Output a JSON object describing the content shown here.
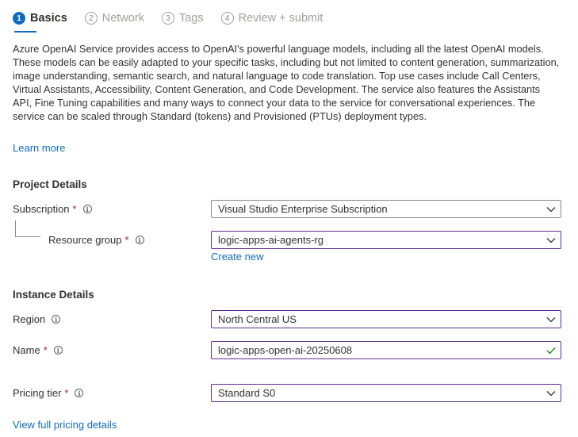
{
  "steps": [
    {
      "number": "1",
      "label": "Basics"
    },
    {
      "number": "2",
      "label": "Network"
    },
    {
      "number": "3",
      "label": "Tags"
    },
    {
      "number": "4",
      "label": "Review + submit"
    }
  ],
  "description": "Azure OpenAI Service provides access to OpenAI's powerful language models, including all the latest OpenAI models. These models can be easily adapted to your specific tasks, including but not limited to content generation, summarization, image understanding, semantic search, and natural language to code translation. Top use cases include Call Centers, Virtual Assistants, Accessibility, Content Generation, and Code Development. The service also features the Assistants API, Fine Tuning capabilities and many ways to connect your data to the service for conversational experiences. The service can be scaled through Standard (tokens) and Provisioned (PTUs) deployment types.",
  "learn_more": "Learn more",
  "project_details": {
    "title": "Project Details",
    "subscription_label": "Subscription",
    "subscription_value": "Visual Studio Enterprise Subscription",
    "resource_group_label": "Resource group",
    "resource_group_value": "logic-apps-ai-agents-rg",
    "create_new": "Create new"
  },
  "instance_details": {
    "title": "Instance Details",
    "region_label": "Region",
    "region_value": "North Central US",
    "name_label": "Name",
    "name_value": "logic-apps-open-ai-20250608",
    "pricing_tier_label": "Pricing tier",
    "pricing_tier_value": "Standard S0"
  },
  "pricing_link": "View full pricing details",
  "required_marker": "*",
  "colors": {
    "accent": "#0f6cbd",
    "required": "#a4262c",
    "focus_border": "#5c2d91",
    "valid": "#107c10"
  }
}
